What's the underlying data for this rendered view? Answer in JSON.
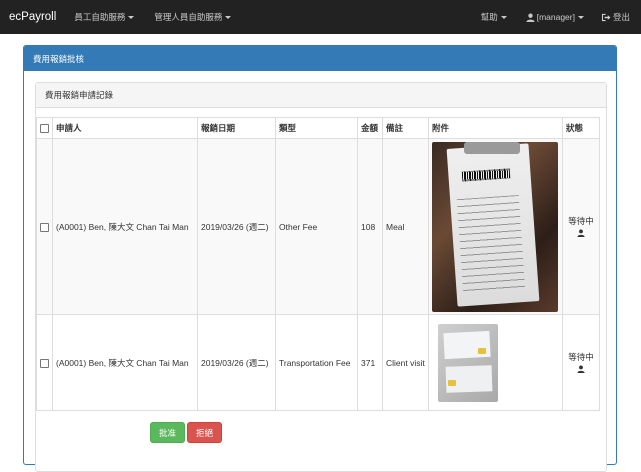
{
  "navbar": {
    "brand": "ecPayroll",
    "menus": [
      {
        "label": "員工自助服務"
      },
      {
        "label": "管理人員自助服務"
      }
    ],
    "help_label": "幫助",
    "user_label": "[manager]",
    "logout_label": "登出"
  },
  "panel": {
    "title": "費用報銷批核",
    "subpanel_title": "費用報銷申請記錄"
  },
  "table": {
    "headers": {
      "applicant": "申請人",
      "date": "報銷日期",
      "type": "類型",
      "amount": "金額",
      "remark": "備註",
      "attachment": "附件",
      "status": "狀態"
    },
    "rows": [
      {
        "applicant": "(A0001) Ben, 陳大文 Chan Tai Man",
        "date": "2019/03/26 (週二)",
        "type": "Other Fee",
        "amount": "108",
        "remark": "Meal",
        "status": "等待中"
      },
      {
        "applicant": "(A0001) Ben, 陳大文 Chan Tai Man",
        "date": "2019/03/26 (週二)",
        "type": "Transportation Fee",
        "amount": "371",
        "remark": "Client visit",
        "status": "等待中"
      }
    ]
  },
  "buttons": {
    "approve": "批准",
    "reject": "拒絕"
  },
  "colors": {
    "navbar_bg": "#222222",
    "panel_primary": "#337ab7",
    "approve": "#5cb85c",
    "reject": "#d9534f"
  }
}
